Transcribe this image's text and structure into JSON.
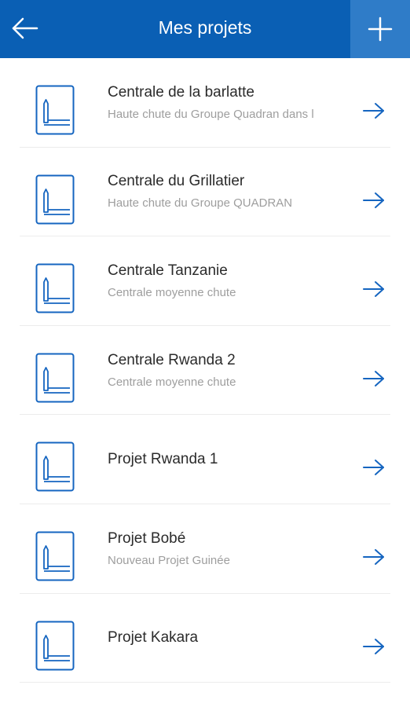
{
  "header": {
    "title": "Mes projets",
    "back_icon": "arrow-left-icon",
    "add_icon": "plus-icon",
    "bg_color": "#0a5fb4",
    "add_bg_color": "#2f7cc8"
  },
  "projects": [
    {
      "name": "Centrale de la barlatte",
      "subtitle": "Haute chute du Groupe Quadran dans l"
    },
    {
      "name": "Centrale du Grillatier",
      "subtitle": "Haute chute du Groupe QUADRAN"
    },
    {
      "name": "Centrale Tanzanie",
      "subtitle": "Centrale moyenne chute"
    },
    {
      "name": "Centrale Rwanda 2",
      "subtitle": "Centrale moyenne chute"
    },
    {
      "name": "Projet Rwanda 1",
      "subtitle": ""
    },
    {
      "name": "Projet Bobé",
      "subtitle": "Nouveau Projet Guinée"
    },
    {
      "name": "Projet Kakara",
      "subtitle": ""
    }
  ],
  "accent_color": "#1565c0"
}
